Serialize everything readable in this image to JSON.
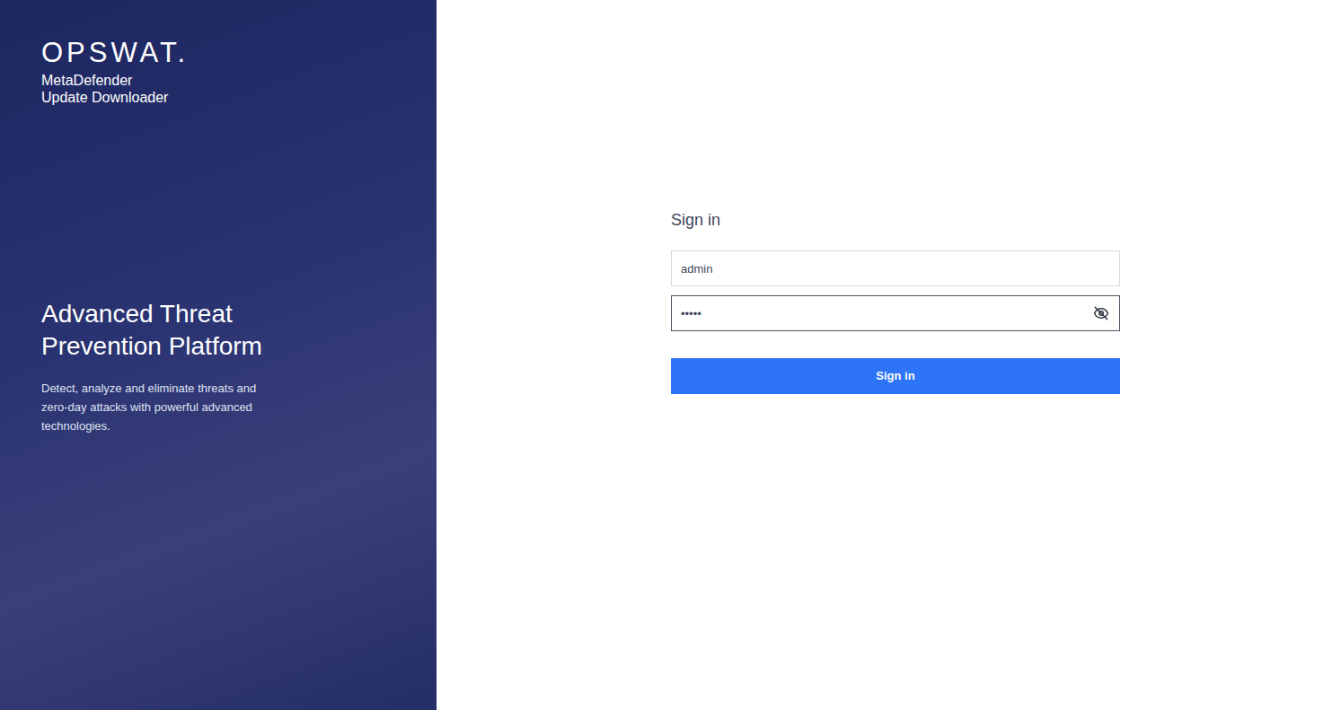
{
  "logo": {
    "brand": "OPSWAT.",
    "product_line1": "MetaDefender",
    "product_line2": "Update Downloader"
  },
  "hero": {
    "title": "Advanced Threat Prevention Platform",
    "description": "Detect, analyze and eliminate threats and zero-day attacks with powerful advanced technologies."
  },
  "form": {
    "title": "Sign in",
    "username": {
      "value": "admin",
      "focused": false
    },
    "password": {
      "value": "•••••",
      "focused": true
    },
    "submit": "Sign in"
  }
}
